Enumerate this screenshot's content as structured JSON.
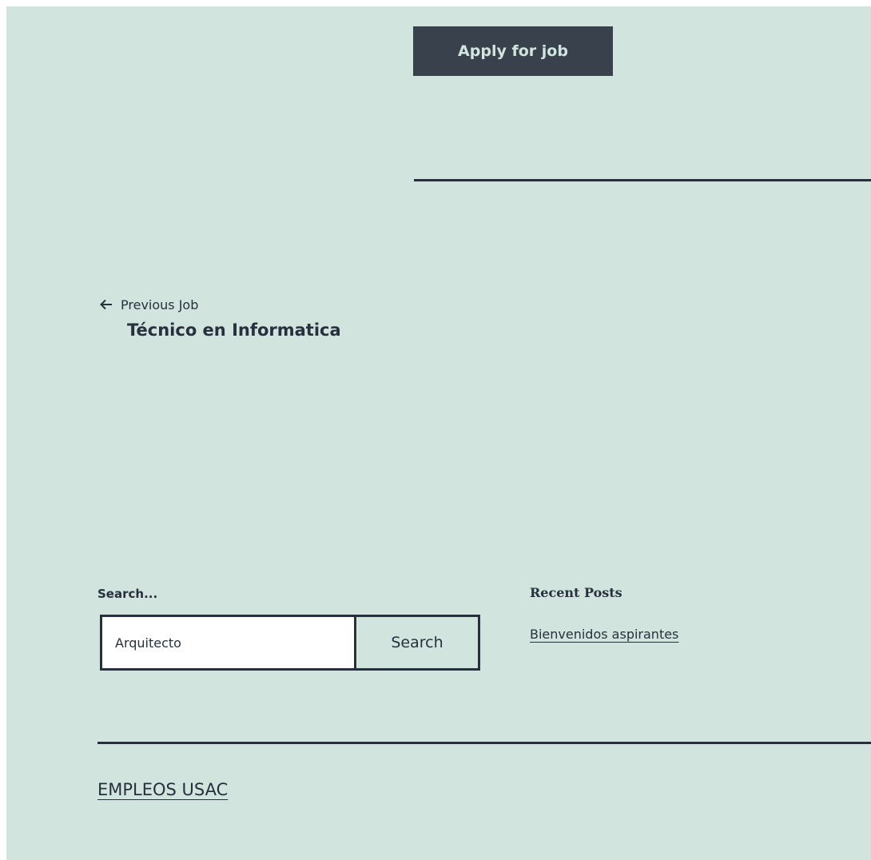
{
  "job": {
    "apply_label": "Apply for job"
  },
  "navigation": {
    "previous_meta": "Previous Job",
    "previous_title": "Técnico en Informatica",
    "arrow_icon": "arrow-left-icon"
  },
  "search": {
    "label": "Search...",
    "input_value": "Arquitecto",
    "button_label": "Search"
  },
  "recent_posts": {
    "title": "Recent Posts",
    "items": [
      {
        "label": "Bienvenidos aspirantes"
      }
    ]
  },
  "footer": {
    "site_name": "EMPLEOS USAC"
  },
  "colors": {
    "background": "#d1e4dd",
    "text": "#28303d",
    "button_background": "#39414d",
    "button_text": "#d1e4dd",
    "input_background": "#ffffff"
  }
}
